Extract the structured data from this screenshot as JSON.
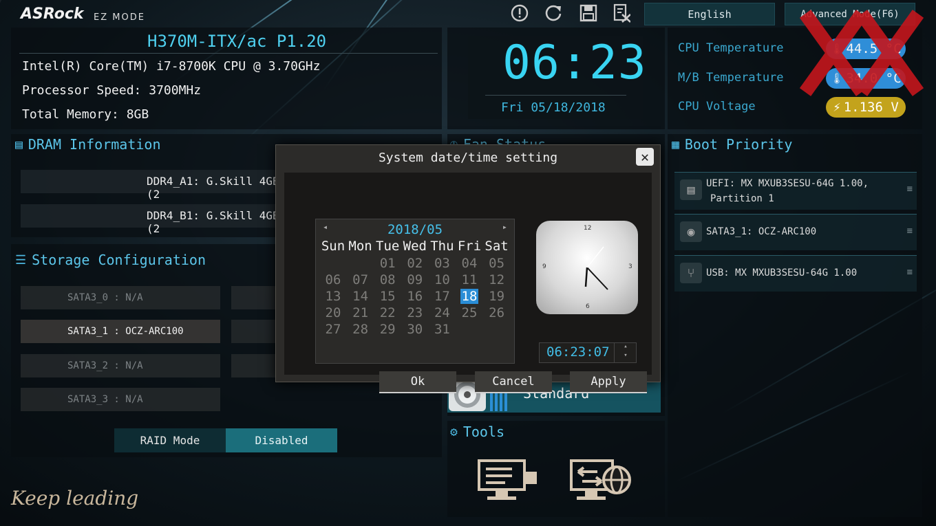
{
  "brand": {
    "logo": "ASRock",
    "mode": "EZ MODE"
  },
  "topbar": {
    "icons": [
      "help-icon",
      "refresh-icon",
      "save-icon",
      "discard-exit-icon"
    ],
    "language_label": "English",
    "advanced_label": "Advanced Mode(F6)"
  },
  "system": {
    "board": "H370M-ITX/ac P1.20",
    "cpu": "Intel(R) Core(TM) i7-8700K CPU @ 3.70GHz",
    "speed": "Processor Speed: 3700MHz",
    "memory": "Total Memory: 8GB"
  },
  "clock": {
    "time": "06:23",
    "date": "Fri 05/18/2018"
  },
  "monitor": {
    "cpu_temp_label": "CPU Temperature",
    "cpu_temp_value": "44.5 °C",
    "mb_temp_label": "M/B Temperature",
    "mb_temp_value": "34.0 °C",
    "cpu_volt_label": "CPU Voltage",
    "cpu_volt_value": "1.136 V",
    "colors": {
      "temp": "#2f8ed8",
      "volt": "#c3a31c"
    }
  },
  "dram": {
    "title": "DRAM Information",
    "slots": [
      "DDR4_A1: G.Skill 4GB (2",
      "DDR4_B1: G.Skill 4GB (2"
    ]
  },
  "storage": {
    "title": "Storage Configuration",
    "ports": [
      "SATA3_0 : N/A",
      "SATA3_1 : OCZ-ARC100",
      "SATA3_2 : N/A",
      "SATA3_3 : N/A"
    ],
    "raid_label": "RAID Mode",
    "raid_value": "Disabled"
  },
  "fan": {
    "title": "Fan Status",
    "mode": "Standard"
  },
  "tools": {
    "title": "Tools"
  },
  "boot": {
    "title": "Boot Priority",
    "items": [
      {
        "line1": "UEFI: MX MXUB3SESU-64G 1.00,",
        "line2": "Partition 1"
      },
      {
        "line1": "SATA3_1: OCZ-ARC100",
        "line2": ""
      },
      {
        "line1": "USB: MX MXUB3SESU-64G 1.00",
        "line2": ""
      }
    ]
  },
  "dialog": {
    "title": "System date/time setting",
    "year_month": "2018/05",
    "weekdays": [
      "Sun",
      "Mon",
      "Tue",
      "Wed",
      "Thu",
      "Fri",
      "Sat"
    ],
    "days": [
      "01",
      "02",
      "03",
      "04",
      "05",
      "06",
      "07",
      "08",
      "09",
      "10",
      "11",
      "12",
      "13",
      "14",
      "15",
      "16",
      "17",
      "18",
      "19",
      "20",
      "21",
      "22",
      "23",
      "24",
      "25",
      "26",
      "27",
      "28",
      "29",
      "30",
      "31"
    ],
    "first_weekday_index": 2,
    "selected_day": "18",
    "clock_numbers": [
      "12",
      "3",
      "6",
      "9"
    ],
    "time_value": "06:23:07",
    "ok_label": "Ok",
    "cancel_label": "Cancel",
    "apply_label": "Apply"
  },
  "watermark": {
    "text": "Keep leading",
    "logo_text": "XX"
  }
}
